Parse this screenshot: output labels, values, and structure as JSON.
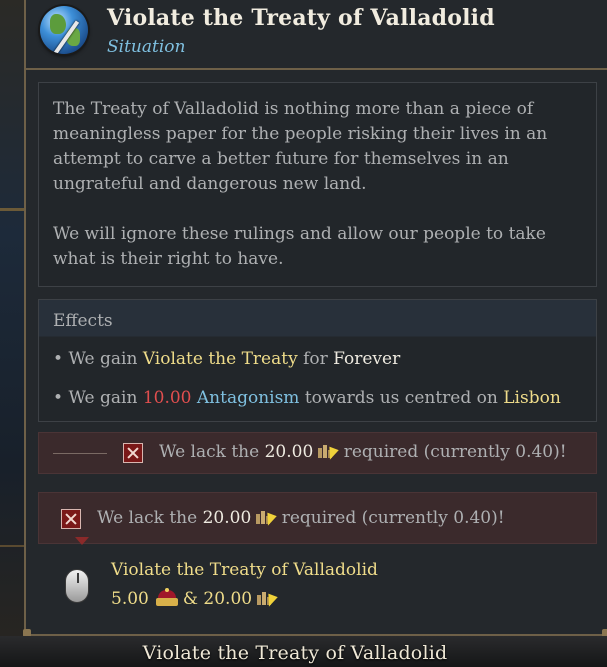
{
  "window": {
    "title": "Violate the Treaty of Valladolid",
    "subtitle": "Situation",
    "icon": "globe-treaty-icon"
  },
  "description": {
    "paragraph_1": "The Treaty of Valladolid is nothing more than a piece of meaningless paper for the people risking their lives in an attempt to carve a better future for themselves in an ungrateful and dangerous new land.",
    "paragraph_2": "We will ignore these rulings and allow our people to take what is their right to have."
  },
  "effects": {
    "heading": "Effects",
    "line1": {
      "bullet": "•",
      "prefix": "We gain",
      "modifier": "Violate the Treaty",
      "middle": "for",
      "duration": "Forever"
    },
    "line2": {
      "bullet": "•",
      "prefix": "We gain",
      "amount": "10.00",
      "stat": "Antagonism",
      "middle": "towards us centred on",
      "location": "Lisbon"
    }
  },
  "requirements": [
    {
      "prefix": "We lack the",
      "amount": "20.00",
      "suffix": "required (currently 0.40)!",
      "icon": "influence-icon"
    },
    {
      "prefix": "We lack the",
      "amount": "20.00",
      "suffix": "required (currently 0.40)!",
      "icon": "influence-icon"
    }
  ],
  "action": {
    "icon": "mouse-click-icon",
    "title": "Violate the Treaty of Valladolid",
    "cost_prestige": "5.00",
    "cost_separator": "&",
    "cost_influence": "20.00"
  },
  "bottom_bar": {
    "label": "Violate the Treaty of Valladolid"
  },
  "colors": {
    "panel_bg": "#24282c",
    "border_gold": "#6e6048",
    "highlight_yellow": "#efdc8a",
    "link_blue": "#7fc0e0",
    "negative_red": "#e04e4e",
    "requirement_bg": "#3b2a2c"
  }
}
